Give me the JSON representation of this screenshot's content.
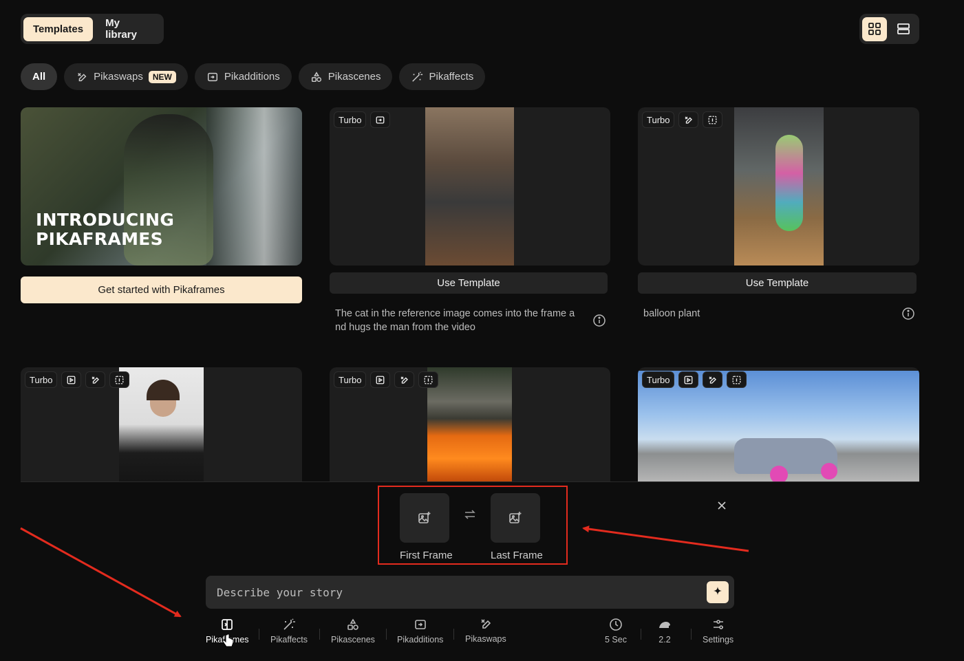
{
  "top_tabs": {
    "templates": "Templates",
    "my_library": "My library"
  },
  "filters": {
    "all": "All",
    "pikaswaps": "Pikaswaps",
    "pikaswaps_badge": "NEW",
    "pikadditions": "Pikadditions",
    "pikascenes": "Pikascenes",
    "pikaffects": "Pikaffects"
  },
  "intro_card": {
    "title": "INTRODUCING\nPIKAFRAMES",
    "cta": "Get started with Pikaframes"
  },
  "cards": [
    {
      "tag": "Turbo",
      "button": "Use Template",
      "description": "The cat in the reference image comes into the frame a nd hugs the man from the video"
    },
    {
      "tag": "Turbo",
      "button": "Use Template",
      "description": "balloon plant"
    },
    {
      "tag": "Turbo"
    },
    {
      "tag": "Turbo"
    },
    {
      "tag": "Turbo"
    }
  ],
  "frames": {
    "first": "First Frame",
    "last": "Last Frame"
  },
  "prompt": {
    "placeholder": "Describe your story"
  },
  "toolbar": {
    "pikaframes": "Pikaframes",
    "pikaffects": "Pikaffects",
    "pikascenes": "Pikascenes",
    "pikadditions": "Pikadditions",
    "pikaswaps": "Pikaswaps",
    "duration": "5 Sec",
    "model": "2.2",
    "settings": "Settings"
  },
  "colors": {
    "accent": "#fbe8cc",
    "annotation": "#e32b1e"
  }
}
